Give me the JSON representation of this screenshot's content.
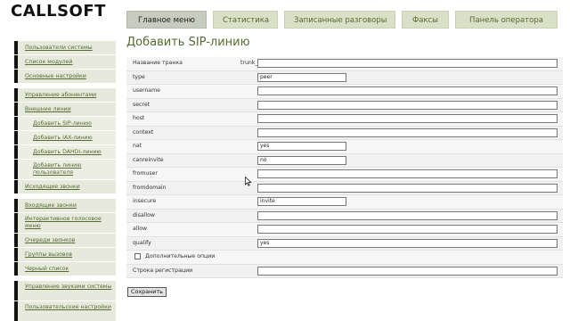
{
  "brand": {
    "logo": "CALLSOFT"
  },
  "tabs": [
    {
      "label": "Главное меню",
      "active": true
    },
    {
      "label": "Статистика",
      "active": false
    },
    {
      "label": "Записанные разговоры",
      "active": false
    },
    {
      "label": "Факсы",
      "active": false
    },
    {
      "label": "Панель оператора",
      "active": false
    }
  ],
  "sidebar": {
    "groups": [
      {
        "items": [
          {
            "label": "Пользователи системы"
          },
          {
            "label": "Список модулей"
          },
          {
            "label": "Основные настройки"
          }
        ]
      },
      {
        "items": [
          {
            "label": "Управление абонентами"
          },
          {
            "label": "Внешние линии"
          },
          {
            "label": "Добавить SIP-линию",
            "sub": true
          },
          {
            "label": "Добавить IAX-линию",
            "sub": true
          },
          {
            "label": "Добавить DAHDI-линию",
            "sub": true
          },
          {
            "label": "Добавить линию пользователя",
            "sub": true,
            "two": true
          },
          {
            "label": "Исходящие звонки"
          }
        ]
      },
      {
        "items": [
          {
            "label": "Входящие звонки"
          },
          {
            "label": "Интерактивное голосовое меню",
            "two": true
          },
          {
            "label": "Очереди звонков"
          },
          {
            "label": "Группы вызовов"
          },
          {
            "label": "Черный список"
          }
        ]
      },
      {
        "items": [
          {
            "label": "Управление звуками системы",
            "two": true
          },
          {
            "label": "Пользовательские настройки",
            "two": true
          }
        ]
      }
    ]
  },
  "page": {
    "title": "Добавить SIP-линию"
  },
  "form": {
    "rows": [
      {
        "label": "Название транка",
        "prefix": "trunk_",
        "value": "",
        "width": "wide"
      },
      {
        "label": "type",
        "value": "peer",
        "width": "short"
      },
      {
        "label": "username",
        "value": "",
        "width": "wide"
      },
      {
        "label": "secret",
        "value": "",
        "width": "wide"
      },
      {
        "label": "host",
        "value": "",
        "width": "wide"
      },
      {
        "label": "context",
        "value": "",
        "width": "wide"
      },
      {
        "label": "nat",
        "value": "yes",
        "width": "short"
      },
      {
        "label": "canreinvite",
        "value": "no",
        "width": "short"
      },
      {
        "label": "fromuser",
        "value": "",
        "width": "wide"
      },
      {
        "label": "fromdomain",
        "value": "",
        "width": "wide"
      },
      {
        "label": "insecure",
        "value": "invite",
        "width": "short"
      },
      {
        "label": "disallow",
        "value": "",
        "width": "wide"
      },
      {
        "label": "allow",
        "value": "",
        "width": "wide"
      },
      {
        "label": "qualify",
        "value": "yes",
        "width": "wide"
      }
    ],
    "extra_options_label": "Дополнительные опции",
    "registration": {
      "label": "Строка регистрации",
      "value": ""
    },
    "save_label": "Сохранить"
  }
}
